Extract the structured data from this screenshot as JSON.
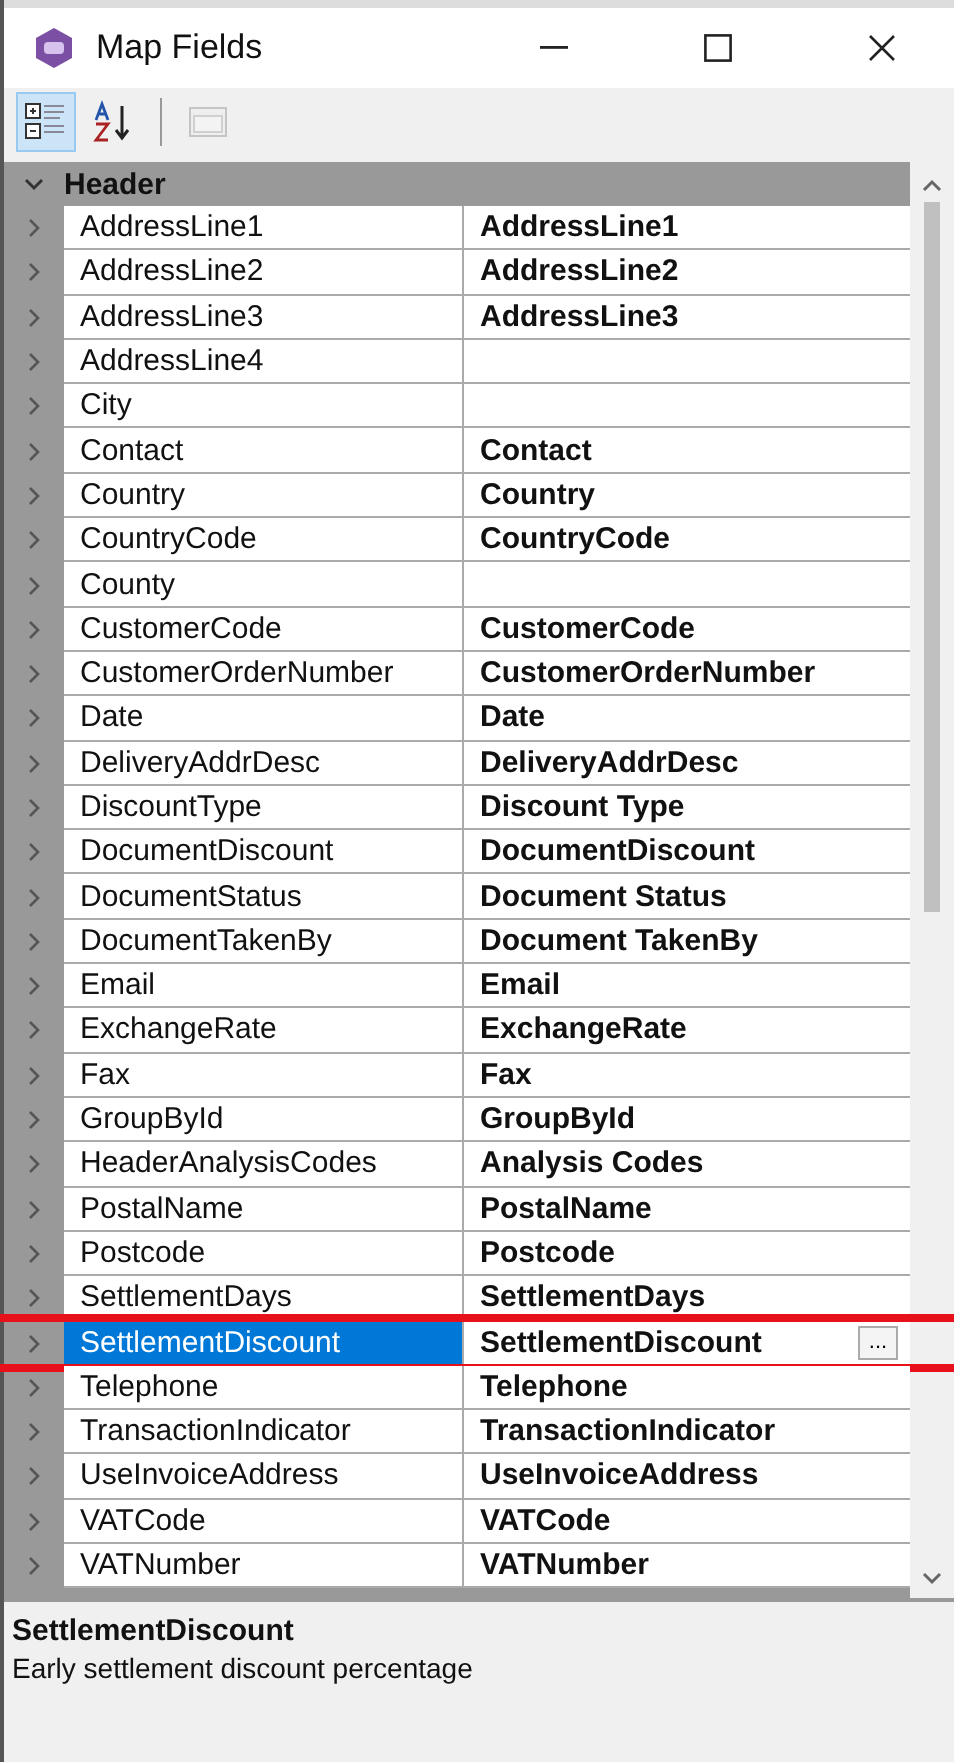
{
  "window": {
    "title": "Map Fields"
  },
  "toolbar": [
    {
      "kind": "categorized",
      "selected": true,
      "disabled": false
    },
    {
      "kind": "alphabetical",
      "selected": false,
      "disabled": false
    },
    {
      "kind": "pages",
      "selected": false,
      "disabled": true
    }
  ],
  "group": {
    "label": "Header",
    "expanded": true
  },
  "rows": [
    {
      "name": "AddressLine1",
      "value": "AddressLine1",
      "selected": false
    },
    {
      "name": "AddressLine2",
      "value": "AddressLine2",
      "selected": false
    },
    {
      "name": "AddressLine3",
      "value": "AddressLine3",
      "selected": false
    },
    {
      "name": "AddressLine4",
      "selected": false
    },
    {
      "name": "City",
      "selected": false
    },
    {
      "name": "Contact",
      "value": "Contact",
      "selected": false
    },
    {
      "name": "Country",
      "value": "Country",
      "selected": false
    },
    {
      "name": "CountryCode",
      "value": "CountryCode",
      "selected": false
    },
    {
      "name": "County",
      "selected": false
    },
    {
      "name": "CustomerCode",
      "value": "CustomerCode",
      "selected": false
    },
    {
      "name": "CustomerOrderNumber",
      "value": "CustomerOrderNumber",
      "selected": false
    },
    {
      "name": "Date",
      "value": "Date",
      "selected": false
    },
    {
      "name": "DeliveryAddrDesc",
      "value": "DeliveryAddrDesc",
      "selected": false
    },
    {
      "name": "DiscountType",
      "value": "Discount Type",
      "selected": false
    },
    {
      "name": "DocumentDiscount",
      "value": "DocumentDiscount",
      "selected": false
    },
    {
      "name": "DocumentStatus",
      "value": "Document Status",
      "selected": false
    },
    {
      "name": "DocumentTakenBy",
      "value": "Document TakenBy",
      "selected": false
    },
    {
      "name": "Email",
      "value": "Email",
      "selected": false
    },
    {
      "name": "ExchangeRate",
      "value": "ExchangeRate",
      "selected": false
    },
    {
      "name": "Fax",
      "value": "Fax",
      "selected": false
    },
    {
      "name": "GroupById",
      "value": "GroupById",
      "selected": false
    },
    {
      "name": "HeaderAnalysisCodes",
      "value": "Analysis Codes",
      "selected": false
    },
    {
      "name": "PostalName",
      "value": "PostalName",
      "selected": false
    },
    {
      "name": "Postcode",
      "value": "Postcode",
      "selected": false
    },
    {
      "name": "SettlementDays",
      "value": "SettlementDays",
      "selected": false
    },
    {
      "name": "SettlementDiscount",
      "value": "SettlementDiscount",
      "selected": true,
      "button": "..."
    },
    {
      "name": "Telephone",
      "value": "Telephone",
      "selected": false
    },
    {
      "name": "TransactionIndicator",
      "value": "TransactionIndicator",
      "selected": false
    },
    {
      "name": "UseInvoiceAddress",
      "value": "UseInvoiceAddress",
      "selected": false
    },
    {
      "name": "VATCode",
      "value": "VATCode",
      "selected": false
    },
    {
      "name": "VATNumber",
      "value": "VATNumber",
      "selected": false
    }
  ],
  "description": {
    "title": "SettlementDiscount",
    "text": "Early settlement discount percentage"
  }
}
